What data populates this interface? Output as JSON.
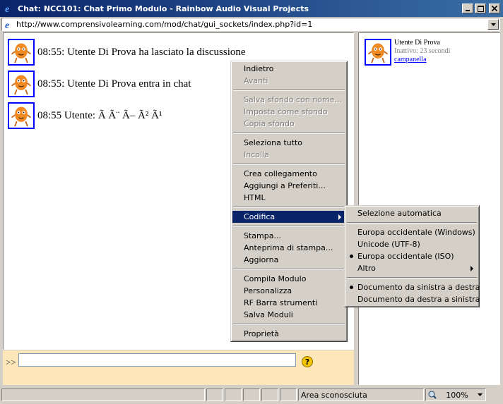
{
  "window": {
    "title": "Chat: NCC101: Chat Primo Modulo - Rainbow Audio Visual Projects",
    "url": "http://www.comprensivolearning.com/mod/chat/gui_sockets/index.php?id=1"
  },
  "messages": [
    {
      "text": "08:55: Utente Di Prova ha lasciato la discussione"
    },
    {
      "text": "08:55: Utente Di Prova entra in chat"
    },
    {
      "text": "08:55 Utente: Ã  Ã¨ Ã– Ã² Ã¹"
    }
  ],
  "user_list": [
    {
      "name": "Utente Di Prova",
      "status": "Inattivo: 23 secondi",
      "link": "campanella"
    }
  ],
  "input": {
    "prompt": ">>",
    "value": "",
    "help": "?"
  },
  "context_menu": {
    "groups": [
      [
        {
          "label": "Indietro",
          "disabled": false
        },
        {
          "label": "Avanti",
          "disabled": true
        }
      ],
      [
        {
          "label": "Salva sfondo con nome...",
          "disabled": true
        },
        {
          "label": "Imposta come sfondo",
          "disabled": true
        },
        {
          "label": "Copia sfondo",
          "disabled": true
        }
      ],
      [
        {
          "label": "Seleziona tutto",
          "disabled": false
        },
        {
          "label": "Incolla",
          "disabled": true
        }
      ],
      [
        {
          "label": "Crea collegamento",
          "disabled": false
        },
        {
          "label": "Aggiungi a Preferiti...",
          "disabled": false
        },
        {
          "label": "HTML",
          "disabled": false
        }
      ],
      [
        {
          "label": "Codifica",
          "disabled": false,
          "active": true,
          "submenu": true
        }
      ],
      [
        {
          "label": "Stampa...",
          "disabled": false
        },
        {
          "label": "Anteprima di stampa...",
          "disabled": false
        },
        {
          "label": "Aggiorna",
          "disabled": false
        }
      ],
      [
        {
          "label": "Compila Modulo",
          "disabled": false
        },
        {
          "label": "Personalizza",
          "disabled": false
        },
        {
          "label": "RF Barra strumenti",
          "disabled": false
        },
        {
          "label": "Salva Moduli",
          "disabled": false
        }
      ],
      [
        {
          "label": "Proprietà",
          "disabled": false
        }
      ]
    ]
  },
  "submenu": {
    "groups": [
      [
        {
          "label": "Selezione automatica"
        }
      ],
      [
        {
          "label": "Europa occidentale (Windows)"
        },
        {
          "label": "Unicode (UTF-8)"
        },
        {
          "label": "Europa occidentale (ISO)",
          "checked": true
        },
        {
          "label": "Altro",
          "submenu": true
        }
      ],
      [
        {
          "label": "Documento da sinistra a destra",
          "checked": true
        },
        {
          "label": "Documento da destra a sinistra"
        }
      ]
    ]
  },
  "statusbar": {
    "zone": "Area sconosciuta",
    "zoom": "100%"
  }
}
